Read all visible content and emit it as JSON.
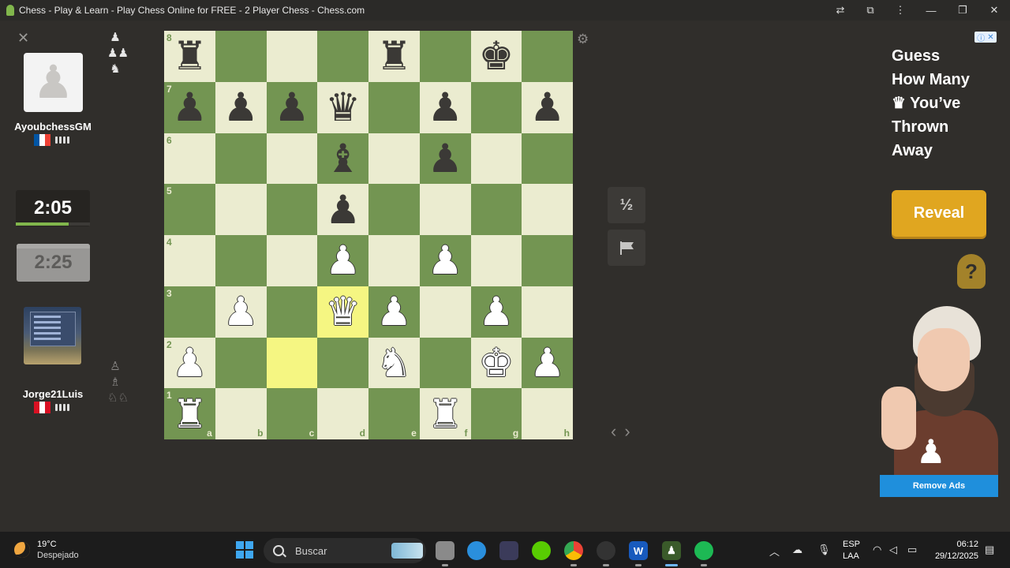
{
  "window": {
    "title": "Chess - Play & Learn - Play Chess Online for FREE - 2 Player Chess - Chess.com",
    "buttons": [
      "translate-icon",
      "extensions-icon",
      "menu-icon",
      "minimize",
      "maximize",
      "close"
    ]
  },
  "players": {
    "top": {
      "name": "AyoubchessGM",
      "clock": "2:05",
      "clock_fraction": 0.71,
      "captured": [
        "♟",
        "♟♟",
        "♞"
      ],
      "flag": [
        "#0055a4",
        "#ffffff",
        "#ef4135"
      ]
    },
    "bottom": {
      "name": "Jorge21Luis",
      "clock": "2:25",
      "captured": [
        "♙",
        "♗",
        "♘♘"
      ],
      "flag": [
        "#d91023",
        "#ffffff",
        "#d91023"
      ]
    }
  },
  "board": {
    "ranks": [
      "8",
      "7",
      "6",
      "5",
      "4",
      "3",
      "2",
      "1"
    ],
    "files": [
      "a",
      "b",
      "c",
      "d",
      "e",
      "f",
      "g",
      "h"
    ],
    "rows": [
      [
        "r",
        "",
        "",
        "",
        "r",
        "",
        "k",
        ""
      ],
      [
        "p",
        "p",
        "p",
        "q",
        "",
        "p",
        "",
        "p"
      ],
      [
        "",
        "",
        "",
        "b",
        "",
        "p",
        "",
        ""
      ],
      [
        "",
        "",
        "",
        "p",
        "",
        "",
        "",
        ""
      ],
      [
        "",
        "",
        "",
        "P",
        "",
        "P",
        "",
        ""
      ],
      [
        "",
        "P",
        "",
        "Q",
        "P",
        "",
        "P",
        ""
      ],
      [
        "P",
        "",
        "",
        "",
        "N",
        "",
        "K",
        "P"
      ],
      [
        "R",
        "",
        "",
        "",
        "",
        "R",
        "",
        ""
      ]
    ],
    "highlighted": [
      "d3",
      "c2"
    ]
  },
  "controls": {
    "draw_label": "½",
    "settings_icon": "gear-icon",
    "resign_icon": "flag-icon",
    "prev": "‹",
    "next": "›"
  },
  "ad": {
    "headline_1": "Guess",
    "headline_2": "How Many",
    "headline_3": "You’ve",
    "headline_4": "Thrown",
    "headline_5": "Away",
    "headline_glyph": "♛",
    "cta": "Reveal",
    "remove": "Remove Ads"
  },
  "taskbar": {
    "temp": "19°C",
    "weather": "Despejado",
    "search_placeholder": "Buscar",
    "lang_1": "ESP",
    "lang_2": "LAA",
    "time": "06:12",
    "date": "29/12/2025"
  }
}
